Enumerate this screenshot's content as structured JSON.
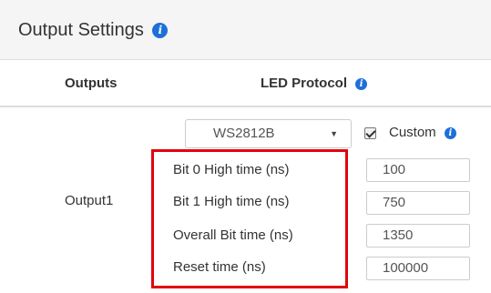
{
  "header": {
    "title": "Output Settings",
    "info_icon": "info-icon"
  },
  "table": {
    "columns": [
      "Outputs",
      "LED Protocol"
    ],
    "protocol_info_icon": "info-icon",
    "row": {
      "output_name": "Output1",
      "protocol_select": {
        "selected": "WS2812B",
        "arrow": "▼"
      },
      "custom_checkbox": {
        "checked": true,
        "label": "Custom",
        "info_icon": "info-icon"
      },
      "params": [
        {
          "label": "Bit 0 High time (ns)",
          "value": "100"
        },
        {
          "label": "Bit 1 High time (ns)",
          "value": "750"
        },
        {
          "label": "Overall Bit time (ns)",
          "value": "1350"
        },
        {
          "label": "Reset time (ns)",
          "value": "100000"
        }
      ]
    }
  },
  "colors": {
    "highlight_border": "#e3000f",
    "info_icon": "#1e6fd9",
    "header_background": "#f5f5f5"
  }
}
